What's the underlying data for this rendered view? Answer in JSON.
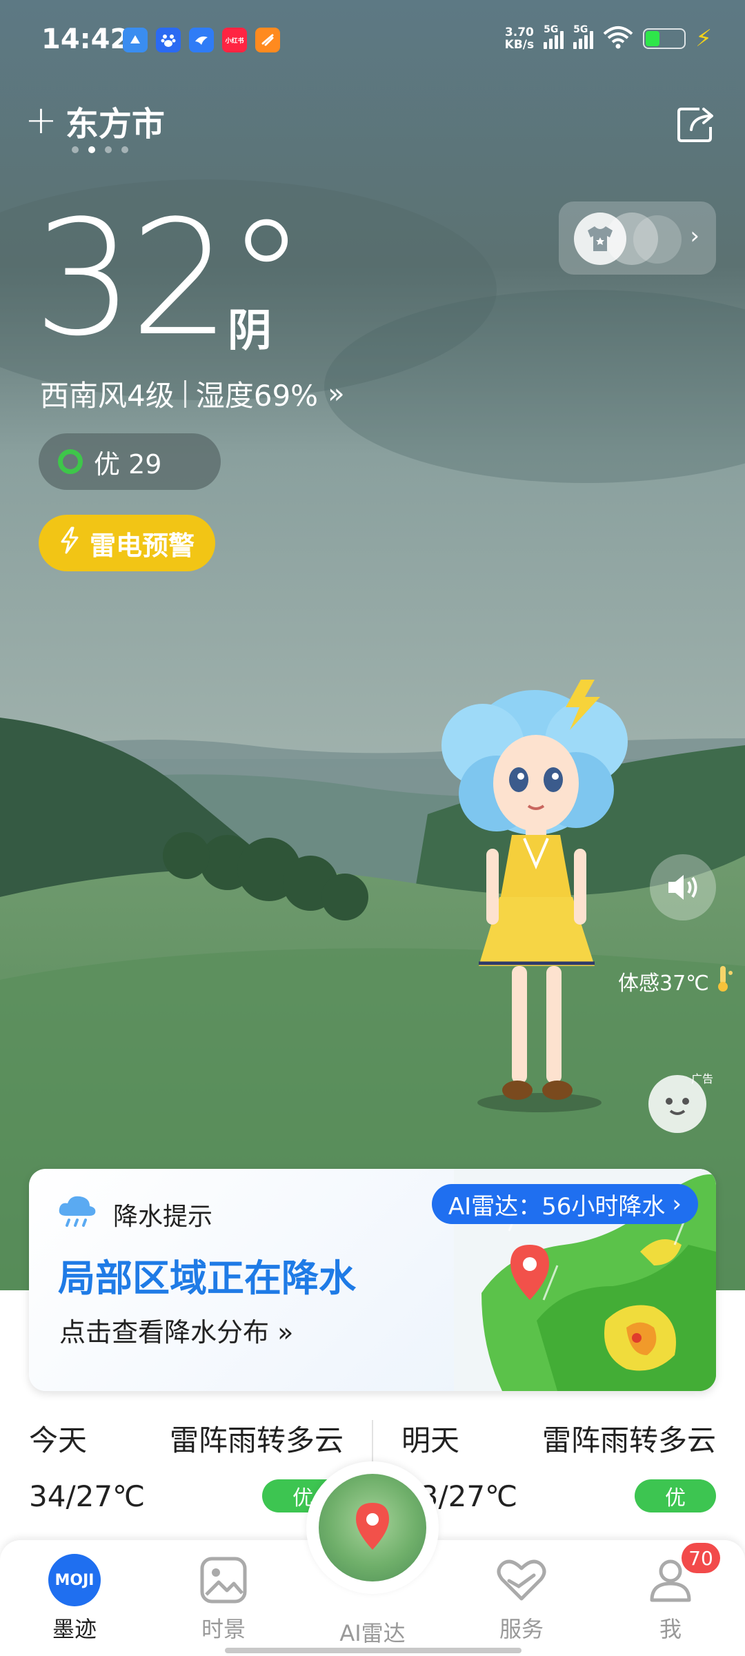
{
  "status_bar": {
    "time": "14:42",
    "net_speed_value": "3.70",
    "net_speed_unit": "KB/s",
    "signal1_label": "5G",
    "signal2_label": "5G",
    "app_icons": [
      "maps-app-icon",
      "baidu-app-icon",
      "bird-app-icon",
      "xiaohongshu-app-icon",
      "orange-app-icon"
    ],
    "xiaohongshu_label": "小红书"
  },
  "header": {
    "add_icon": "plus-icon",
    "city": "东方市",
    "page_count": 4,
    "active_page": 2,
    "share_icon": "share-icon"
  },
  "current": {
    "temperature": "32°",
    "condition": "阴",
    "wind": "西南风4级",
    "humidity": "湿度69%",
    "more_icon": "double-chevron-right-icon",
    "aqi_label": "优 29",
    "aqi_color": "#3ec64a",
    "alert_label": "雷电预警",
    "alert_color": "#f2c515",
    "feels_like": "体感37℃"
  },
  "widgets": {
    "dress_icon": "tshirt-icon",
    "speaker_icon": "speaker-icon",
    "ad_label": "广告"
  },
  "precip_card": {
    "title": "降水提示",
    "radar_badge": "AI雷达：56小时降水",
    "headline": "局部区域正在降水",
    "sub": "点击查看降水分布",
    "accent": "#1f7be6",
    "badge_color": "#1f6ff0"
  },
  "forecast": [
    {
      "day": "今天",
      "desc": "雷阵雨转多云",
      "temp": "34/27℃",
      "aqi": "优"
    },
    {
      "day": "明天",
      "desc": "雷阵雨转多云",
      "temp": "33/27℃",
      "aqi": "优"
    }
  ],
  "nav": {
    "items": [
      {
        "label": "墨迹",
        "icon": "moji-logo-icon",
        "logo_text": "MOJI"
      },
      {
        "label": "时景",
        "icon": "photo-icon"
      },
      {
        "label": "AI雷达",
        "icon": "radar-pin-icon"
      },
      {
        "label": "服务",
        "icon": "heart-hand-icon"
      },
      {
        "label": "我",
        "icon": "user-icon"
      }
    ],
    "badge": "70",
    "badge_color": "#f24a4a"
  }
}
